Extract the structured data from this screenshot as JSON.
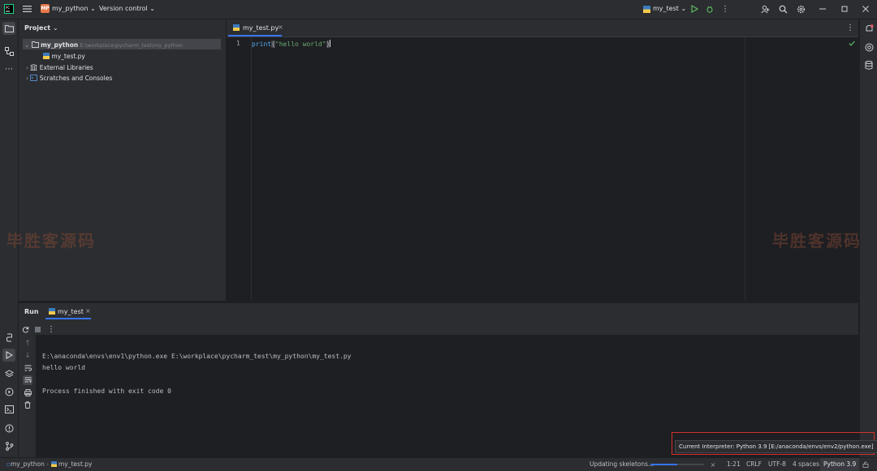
{
  "titlebar": {
    "project_badge": "MP",
    "project_name": "my_python",
    "vcs": "Version control",
    "run_config": "my_test"
  },
  "project_panel": {
    "title": "Project",
    "root_name": "my_python",
    "root_path": "E:\\workplace\\pycharm_test\\my_python",
    "file": "my_test.py",
    "external": "External Libraries",
    "scratches": "Scratches and Consoles"
  },
  "editor": {
    "tab": "my_test.py",
    "line_number": "1",
    "code": {
      "func": "print",
      "paren_open": "(",
      "string": "\"hello world\"",
      "paren_close": ")"
    }
  },
  "watermark": "毕胜客源码",
  "run": {
    "title": "Run",
    "tab": "my_test",
    "lines": [
      "E:\\anaconda\\envs\\env1\\python.exe E:\\workplace\\pycharm_test\\my_python\\my_test.py",
      "hello world",
      "",
      "Process finished with exit code 0"
    ]
  },
  "interpreter_tooltip": "Current Interpreter: Python 3.9 [E:/anaconda/envs/env2/python.exe]",
  "statusbar": {
    "crumb_root": "my_python",
    "crumb_file": "my_test.py",
    "progress_text": "Updating skeletons...",
    "progress_fraction": 0.5,
    "position": "1:21",
    "line_sep": "CRLF",
    "encoding": "UTF-8",
    "indent": "4 spaces",
    "interpreter": "Python 3.9"
  },
  "colors": {
    "accent": "#3574f0",
    "highlight_box": "#d32f2f",
    "string": "#6aab73",
    "func": "#56a8f5"
  }
}
